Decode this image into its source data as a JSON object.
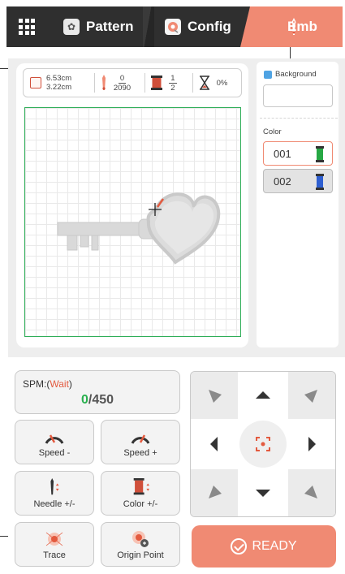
{
  "header": {
    "tabs": [
      {
        "label": "Pattern",
        "active": false
      },
      {
        "label": "Config",
        "active": false
      },
      {
        "label": "Emb",
        "active": true
      }
    ]
  },
  "stats": {
    "width": "6.53cm",
    "height": "3.22cm",
    "stitch_current": "0",
    "stitch_total": "2090",
    "color_current": "1",
    "color_total": "2",
    "progress": "0%"
  },
  "sidebar": {
    "background_label": "Background",
    "color_label": "Color",
    "colors": [
      {
        "id": "001",
        "color": "#27a844",
        "selected": true
      },
      {
        "id": "002",
        "color": "#2f5fd0",
        "selected": false
      }
    ]
  },
  "spm": {
    "label": "SPM:(",
    "status": "Wait",
    "label_end": ")",
    "current": "0",
    "separator": "/",
    "max": "450"
  },
  "controls": {
    "speed_minus": "Speed -",
    "speed_plus": "Speed +",
    "needle": "Needle +/-",
    "color": "Color +/-",
    "trace": "Trace",
    "origin": "Origin Point"
  },
  "ready_label": "READY",
  "colors": {
    "accent": "#f08a73",
    "dark": "#2f2f2f",
    "green": "#29b04e"
  }
}
